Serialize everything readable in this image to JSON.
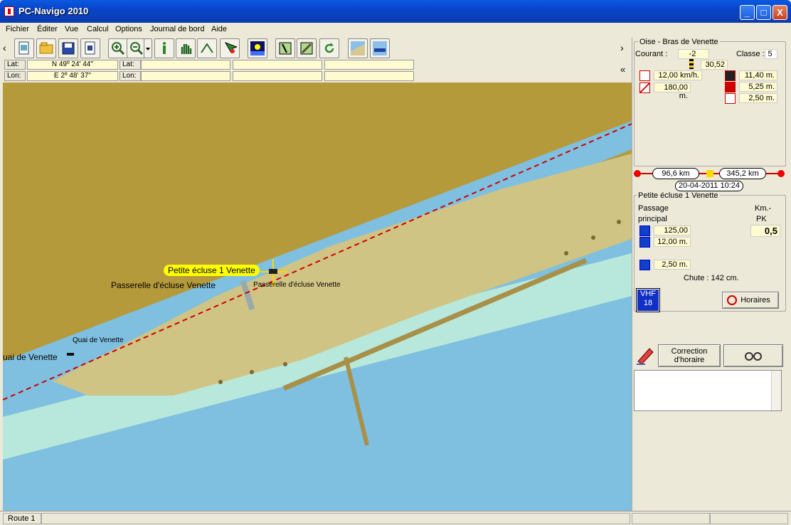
{
  "window": {
    "title": "PC-Navigo 2010",
    "min_label": "_",
    "max_label": "□",
    "close_label": "X"
  },
  "menu": [
    "Fichier",
    "Éditer",
    "Vue",
    "Calcul",
    "Options",
    "Journal de bord",
    "Aide"
  ],
  "toolbar": {
    "left_arrow": "‹",
    "right_arrow": "›",
    "collapse": "«"
  },
  "coords": {
    "lat_label": "Lat:",
    "lon_label": "Lon:",
    "lat_value": "N 49º 24' 44''",
    "lon_value": "E 2º 48' 37''",
    "lat2_label": "Lat:",
    "lon2_label": "Lon:"
  },
  "map": {
    "labels": {
      "lock_name": "Petite écluse 1 Venette",
      "bridge_left": "Passerelle d'écluse Venette",
      "bridge_right": "Passerelle d'écluse Venette",
      "quai": "Quai de Venette",
      "quai_left": "uai de Venette"
    },
    "colors": {
      "land": "#b59a3c",
      "water": "#7fbfe0",
      "shallow": "#b8e8dc",
      "island": "#cfc484",
      "route": "#d00000"
    }
  },
  "panel": {
    "waterway": "Oise - Bras de Venette",
    "courant_label": "Courant :",
    "courant_value": "-2",
    "classe_label": "Classe :",
    "classe_value": "5",
    "depth_value": "30,52",
    "speed": "12,00 km/h.",
    "length": "180,00 m.",
    "height1": "11,40 m.",
    "height2": "5,25 m.",
    "height3": "2,50 m.",
    "dist_left": "96,6 km",
    "dist_right": "345,2 km",
    "datetime": "20-04-2011 10:24",
    "lock_title": "Petite écluse 1 Venette",
    "passage_label": "Passage",
    "principal_label": "principal",
    "km_label": "Km.-",
    "pk_label": "PK",
    "pk_value": "0,5",
    "lock_length": "125,00 m.",
    "lock_width": "12,00 m.",
    "lock_depth": "2,50 m.",
    "chute": "Chute : 142 cm.",
    "vhf_label": "VHF",
    "vhf_channel": "18",
    "horaires_button": "Horaires",
    "correction_button_l1": "Correction",
    "correction_button_l2": "d'horaire"
  },
  "status": {
    "route": "Route 1"
  }
}
